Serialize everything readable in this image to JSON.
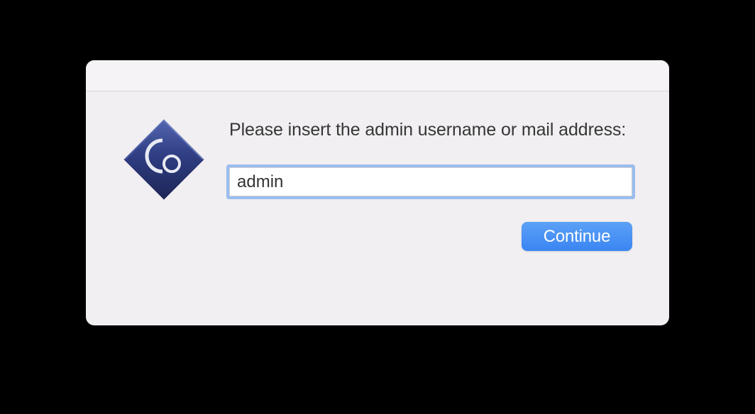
{
  "dialog": {
    "prompt": "Please insert the admin username or mail address:",
    "input_value": "admin",
    "continue_label": "Continue"
  },
  "colors": {
    "accent": "#3a85f3",
    "icon_primary": "#29367a",
    "icon_highlight": "#5466b1"
  }
}
